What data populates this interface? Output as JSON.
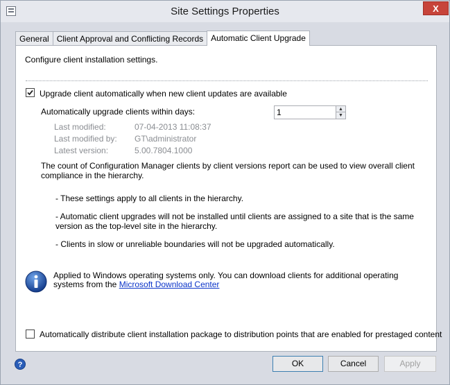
{
  "window": {
    "title": "Site Settings Properties",
    "close_label": "X"
  },
  "tabs": [
    {
      "label": "General"
    },
    {
      "label": "Client Approval and Conflicting Records"
    },
    {
      "label": "Automatic Client Upgrade"
    }
  ],
  "panel": {
    "intro": "Configure client installation settings.",
    "upgrade_checkbox": {
      "label": "Upgrade client automatically when new client updates are available",
      "checked": true
    },
    "days_label": "Automatically upgrade clients within days:",
    "days_value": "1",
    "details": {
      "last_modified_label": "Last modified:",
      "last_modified_value": "07-04-2013 11:08:37",
      "last_modified_by_label": "Last modified by:",
      "last_modified_by_value": "GT\\administrator",
      "latest_version_label": "Latest version:",
      "latest_version_value": "5.00.7804.1000"
    },
    "report_note": "The count of Configuration Manager clients by client versions report can be used to view overall client compliance in the hierarchy.",
    "notes": [
      "- These settings apply to all clients in the hierarchy.",
      "- Automatic client upgrades will not be installed until clients are assigned to a site that is the same version as the top-level site in the hierarchy.",
      "- Clients in slow or unreliable boundaries will not be upgraded automatically."
    ],
    "info_text": "Applied to Windows operating systems only. You can download clients for additional operating systems from the",
    "info_link": "Microsoft Download Center",
    "distribute_checkbox": {
      "label": "Automatically distribute client installation package to distribution points that are enabled for prestaged content",
      "checked": false
    }
  },
  "footer": {
    "ok": "OK",
    "cancel": "Cancel",
    "apply": "Apply"
  },
  "icons": {
    "app": "window-icon",
    "info": "info-icon",
    "help": "help-icon"
  }
}
